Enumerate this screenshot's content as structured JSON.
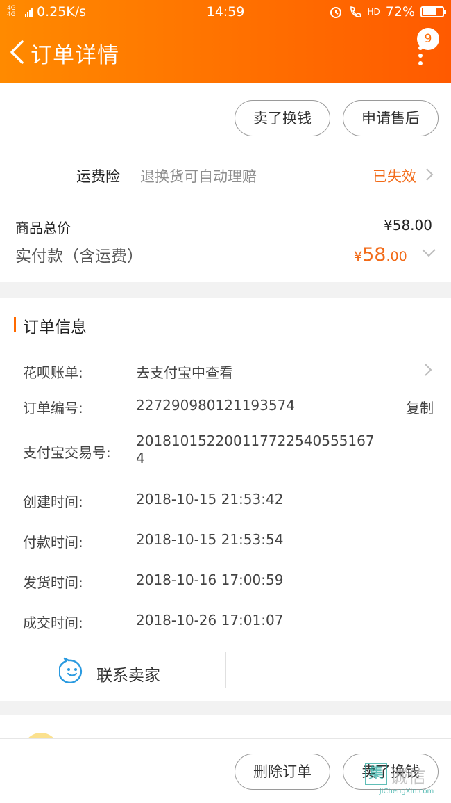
{
  "status": {
    "network": "4G 4G",
    "speed": "0.25K/s",
    "time": "14:59",
    "hd": "HD",
    "battery": "72%",
    "battery_level": 0.72
  },
  "header": {
    "title": "订单详情",
    "badge": "9"
  },
  "actions": {
    "sell": "卖了换钱",
    "after_sale": "申请售后"
  },
  "insurance": {
    "label": "运费险",
    "desc": "退换货可自动理赔",
    "status": "已失效"
  },
  "price": {
    "total_label": "商品总价",
    "total_value": "¥58.00",
    "paid_label": "实付款（含运费）",
    "currency": "¥",
    "paid_int": "58",
    "paid_dec": ".00"
  },
  "order_info": {
    "title": "订单信息",
    "rows": [
      {
        "label": "花呗账单:",
        "value": "去支付宝中查看"
      },
      {
        "label": "订单编号:",
        "value": "227290980121193574",
        "action": "复制"
      },
      {
        "label": "支付宝交易号:",
        "value": "201810152200117722540555167",
        "value2": "4"
      },
      {
        "label": "创建时间:",
        "value": "2018-10-15 21:53:42"
      },
      {
        "label": "付款时间:",
        "value": "2018-10-15 21:53:54"
      },
      {
        "label": "发货时间:",
        "value": "2018-10-16 17:00:59"
      },
      {
        "label": "成交时间:",
        "value": "2018-10-26 17:01:07"
      }
    ],
    "contact": "联系卖家"
  },
  "bottom": {
    "delete": "删除订单",
    "sell": "卖了换钱"
  },
  "watermark": {
    "box": "集",
    "cn": "诚信",
    "en": "JiChengXin.com"
  },
  "colors": {
    "accent": "#ff6a00",
    "price": "#f26a17",
    "contact_icon": "#2a9ae0"
  }
}
